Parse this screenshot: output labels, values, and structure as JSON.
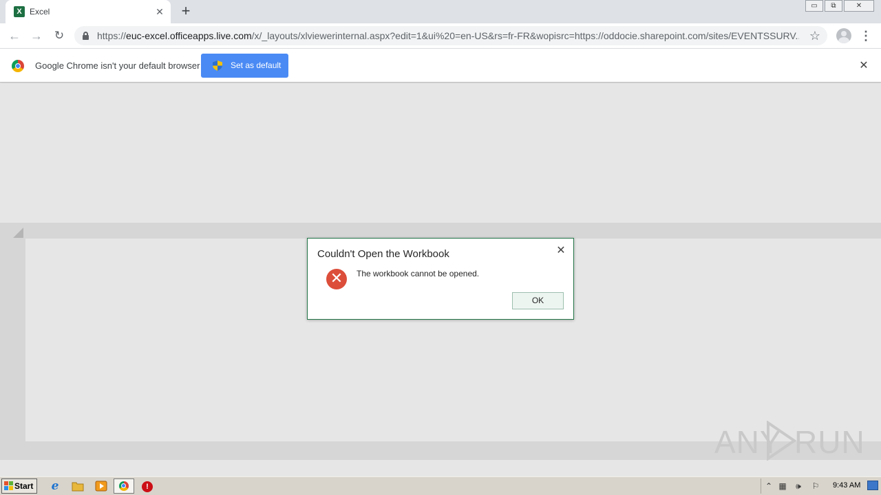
{
  "browser": {
    "tab": {
      "title": "Excel",
      "favicon_letter": "X"
    },
    "new_tab_label": "+",
    "window_controls": {
      "minimize": "▭",
      "restore": "⧉",
      "close": "✕"
    },
    "url": {
      "scheme": "https://",
      "host": "euc-excel.officeapps.live.com",
      "path": "/x/_layouts/xlviewerinternal.aspx?edit=1&ui%20=en-US&rs=fr-FR&wopisrc=https://oddocie.sharepoint.com/sites/EVENTSSURV..."
    },
    "infobar": {
      "message": "Google Chrome isn't your default browser",
      "button_label": "Set as default"
    }
  },
  "dialog": {
    "title": "Couldn't Open the Workbook",
    "message": "The workbook cannot be opened.",
    "ok_label": "OK"
  },
  "watermark": {
    "left": "ANY",
    "right": "RUN"
  },
  "taskbar": {
    "start_label": "Start",
    "clock": "9:43 AM"
  },
  "colors": {
    "excel_green": "#217346",
    "chrome_blue_button": "#4a8af4",
    "error_red": "#dc4e3a",
    "app_background": "#e6e6e6"
  }
}
